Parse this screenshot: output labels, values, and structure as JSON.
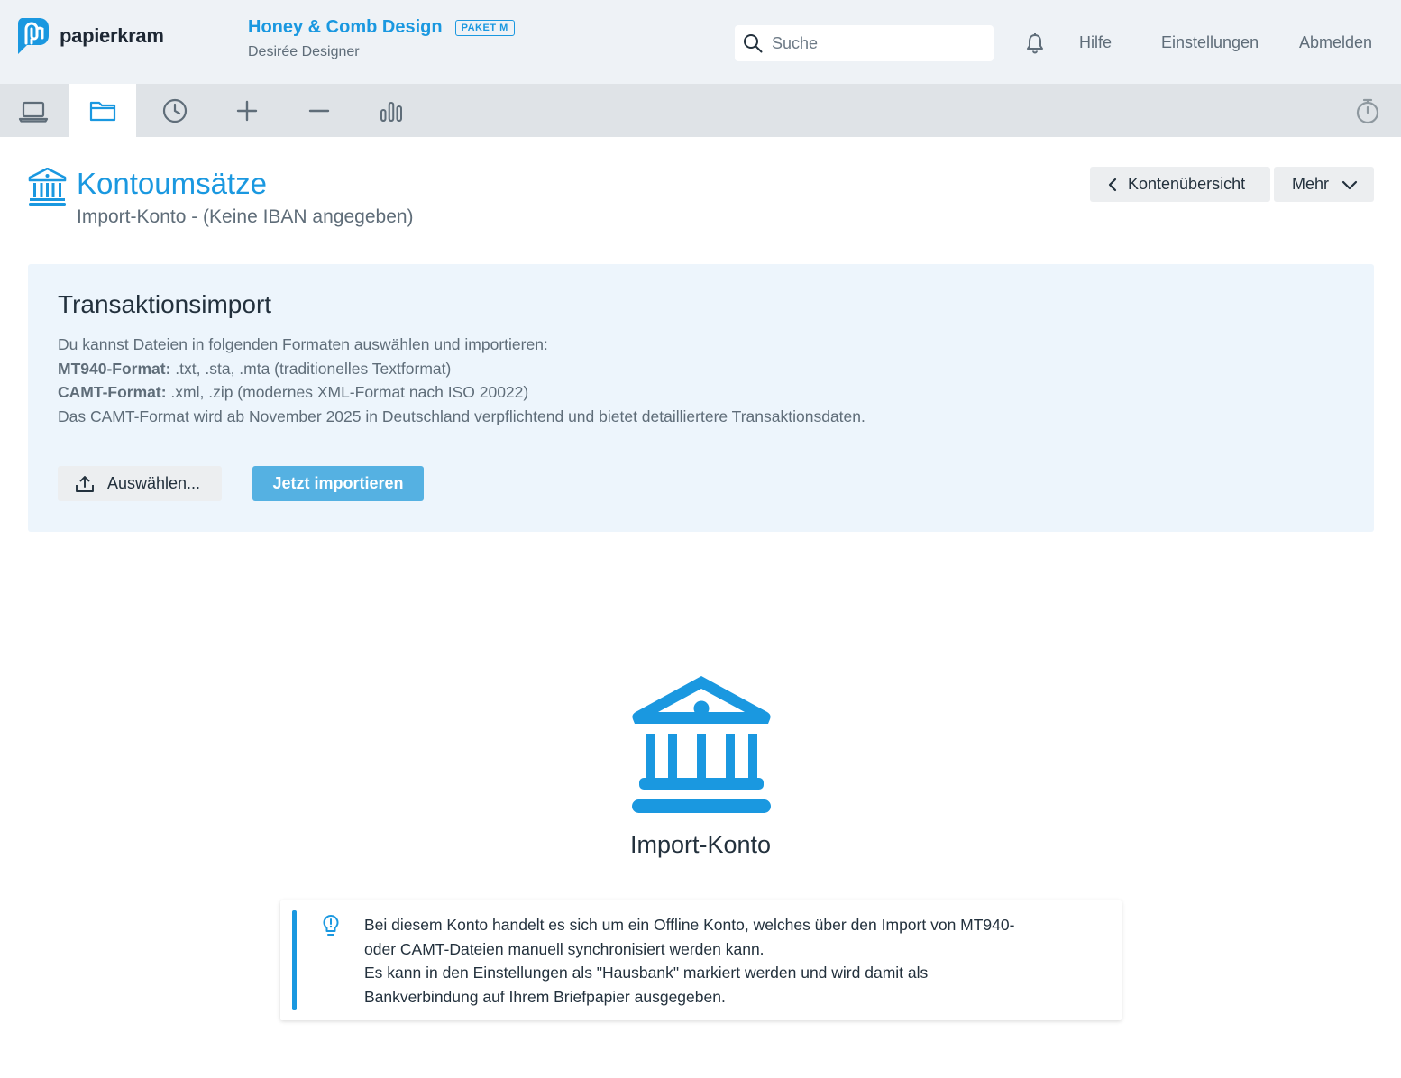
{
  "header": {
    "brand": "papierkram",
    "company_name": "Honey & Comb Design",
    "plan_badge": "PAKET M",
    "user_name": "Desirée Designer",
    "search_placeholder": "Suche",
    "nav": {
      "help": "Hilfe",
      "settings": "Einstellungen",
      "logout": "Abmelden"
    }
  },
  "toolbar": {
    "items": [
      {
        "icon": "laptop-icon",
        "active": false
      },
      {
        "icon": "folder-icon",
        "active": true
      },
      {
        "icon": "clock-icon",
        "active": false
      },
      {
        "icon": "plus-icon",
        "active": false
      },
      {
        "icon": "minus-icon",
        "active": false
      },
      {
        "icon": "bar-chart-icon",
        "active": false
      }
    ],
    "right_icon": "stopwatch-icon"
  },
  "page": {
    "title": "Kontoumsätze",
    "subtitle": "Import-Konto - (Keine IBAN angegeben)",
    "back_button": "Kontenübersicht",
    "more_button": "Mehr"
  },
  "import": {
    "title": "Transaktionsimport",
    "intro": "Du kannst Dateien in folgenden Formaten auswählen und importieren:",
    "mt940_label": "MT940-Format:",
    "mt940_text": " .txt, .sta, .mta (traditionelles Textformat)",
    "camt_label": "CAMT-Format:",
    "camt_text": " .xml, .zip (modernes XML-Format nach ISO 20022)",
    "note": "Das CAMT-Format wird ab November 2025 in Deutschland verpflichtend und bietet detailliertere Transaktionsdaten.",
    "select_button": "Auswählen...",
    "import_button": "Jetzt importieren"
  },
  "empty_state": {
    "title": "Import-Konto",
    "info_line1": "Bei diesem Konto handelt es sich um ein Offline Konto, welches über den Import von MT940-",
    "info_line2": "oder CAMT-Dateien manuell synchronisiert werden kann.",
    "info_line3": "Es kann in den Einstellungen als \"Hausbank\" markiert werden und wird damit als",
    "info_line4": "Bankverbindung auf Ihrem Briefpapier ausgegeben."
  },
  "colors": {
    "brand_blue": "#1a98e0",
    "import_button": "#55b1e2",
    "header_bg": "#eef2f6",
    "toolbar_bg": "#dfe3e7",
    "panel_bg": "#edf5fc"
  }
}
